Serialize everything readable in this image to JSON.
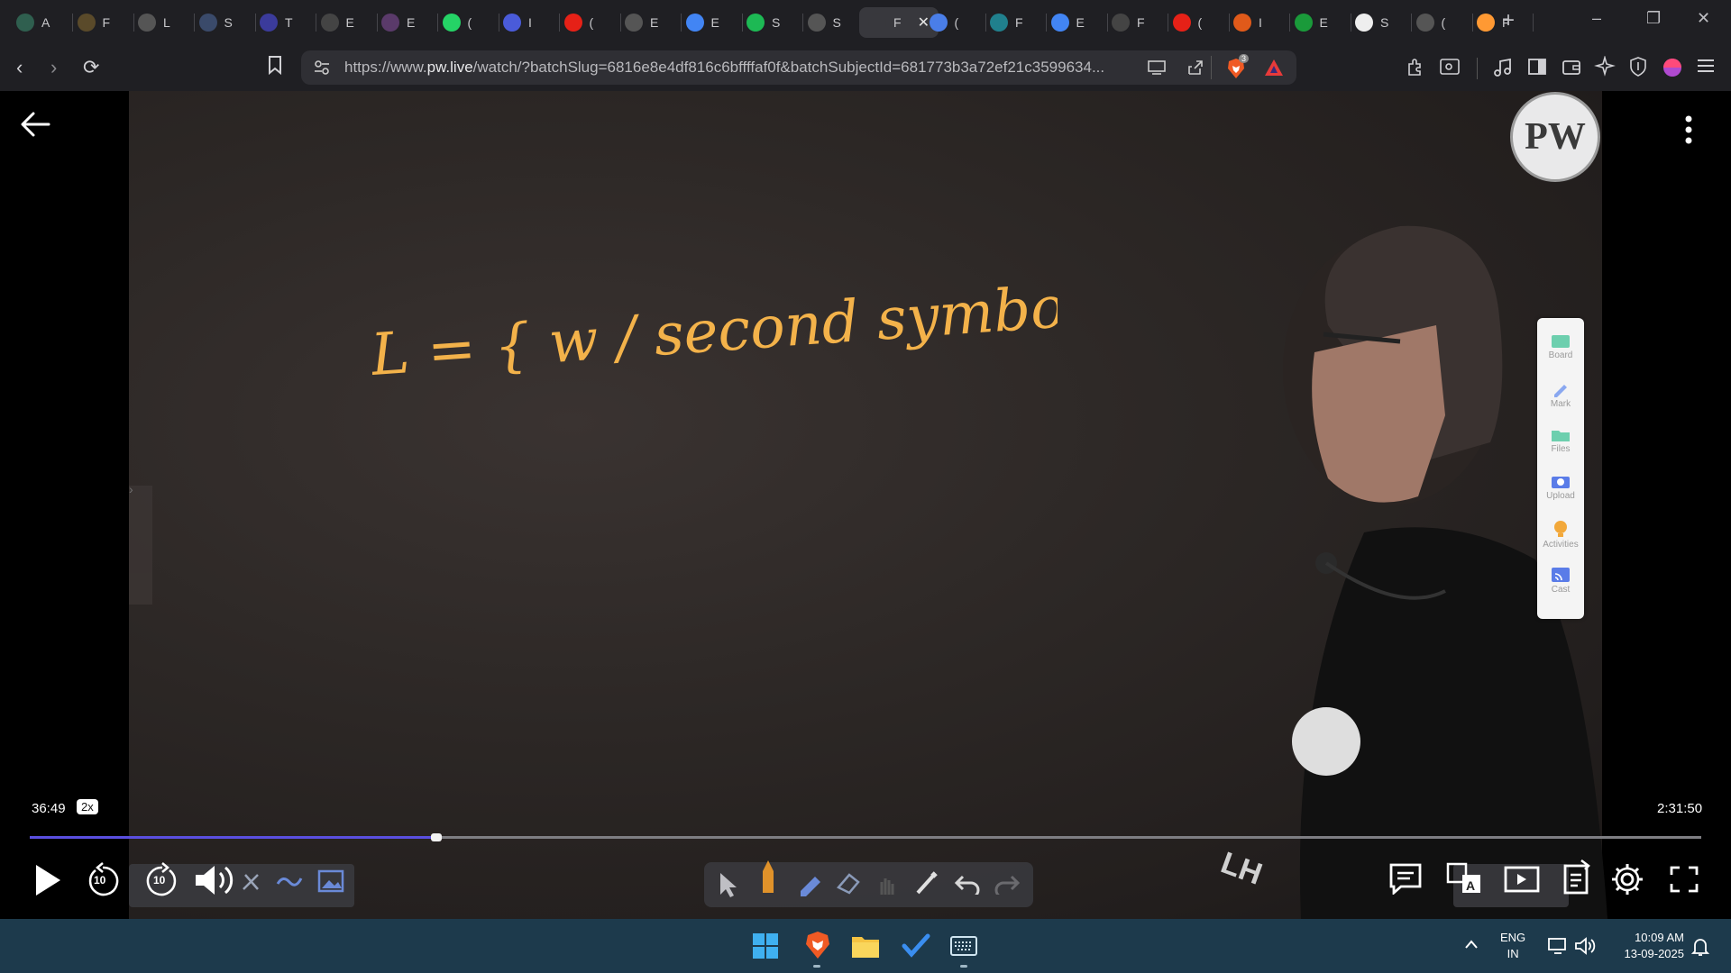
{
  "browser": {
    "tabs": [
      {
        "label": "A",
        "icon": "chatgpt-icon",
        "color": "#2f5f4f"
      },
      {
        "label": "F",
        "icon": "funnel-icon",
        "color": "#5a4a2a"
      },
      {
        "label": "L",
        "icon": "globe-icon",
        "color": "#555"
      },
      {
        "label": "S",
        "icon": "circle-logo-icon",
        "color": "#3a4a6a"
      },
      {
        "label": "T",
        "icon": "w3-icon",
        "color": "#3b3b9b"
      },
      {
        "label": "E",
        "icon": "circle-logo-icon",
        "color": "#444"
      },
      {
        "label": "E",
        "icon": "circle-logo-icon",
        "color": "#5a3a6a"
      },
      {
        "label": "(",
        "icon": "whatsapp-icon",
        "color": "#25d366"
      },
      {
        "label": "I",
        "icon": "bookmark-tag-icon",
        "color": "#4a5bd9"
      },
      {
        "label": "(",
        "icon": "youtube-icon",
        "color": "#e62117"
      },
      {
        "label": "E",
        "icon": "oracle-icon",
        "color": "#555"
      },
      {
        "label": "E",
        "icon": "google-icon",
        "color": "#4285f4"
      },
      {
        "label": "S",
        "icon": "spotify-icon",
        "color": "#1db954"
      },
      {
        "label": "S",
        "icon": "globe-icon",
        "color": "#555"
      },
      {
        "label": "F",
        "icon": "pw-icon",
        "color": "#38383d",
        "active": true
      },
      {
        "label": "(",
        "icon": "gemini-icon",
        "color": "#4a7ee8"
      },
      {
        "label": "F",
        "icon": "perplexity-icon",
        "color": "#20808d"
      },
      {
        "label": "E",
        "icon": "google-icon",
        "color": "#4285f4"
      },
      {
        "label": "F",
        "icon": "screen-icon",
        "color": "#444"
      },
      {
        "label": "(",
        "icon": "youtube-icon",
        "color": "#e62117"
      },
      {
        "label": "I",
        "icon": "hamburger-logo-icon",
        "color": "#e05a1a"
      },
      {
        "label": "E",
        "icon": "book-icon",
        "color": "#1a9a3a"
      },
      {
        "label": "S",
        "icon": "wikipedia-icon",
        "color": "#eee"
      },
      {
        "label": "(",
        "icon": "globe-icon",
        "color": "#555"
      },
      {
        "label": "F",
        "icon": "india-flag-icon",
        "color": "#ff9933"
      }
    ],
    "url_prefix": "https://www.",
    "url_domain": "pw.live",
    "url_rest": "/watch/?batchSlug=6816e8e4df816c6bffffaf0f&batchSubjectId=681773b3a72ef21c3599634...",
    "brave_badge": "3"
  },
  "video": {
    "board_text": "L = { w / second symbol in 'a' }",
    "logo_text": "PW",
    "current_time": "36:49",
    "speed": "2x",
    "total_time": "2:31:50",
    "progress": 0.242,
    "skip_back": "10",
    "skip_forward": "10",
    "side_panel": [
      "Board",
      "Mark",
      "Files",
      "Upload",
      "Activities",
      "Cast"
    ]
  },
  "taskbar": {
    "lang_line1": "ENG",
    "lang_line2": "IN",
    "time": "10:09 AM",
    "date": "13-09-2025"
  }
}
